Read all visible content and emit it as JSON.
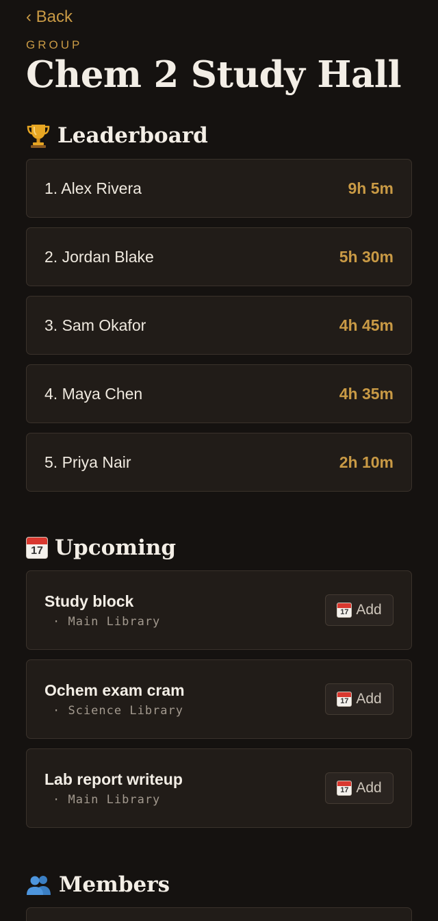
{
  "nav": {
    "back_label": "‹ Back"
  },
  "header": {
    "eyebrow": "GROUP",
    "title": "Chem 2 Study Hall"
  },
  "leaderboard": {
    "heading": "Leaderboard",
    "icon": "trophy-icon",
    "rows": [
      {
        "label": "1. Alex Rivera",
        "time": "9h 5m"
      },
      {
        "label": "2. Jordan Blake",
        "time": "5h 30m"
      },
      {
        "label": "3. Sam Okafor",
        "time": "4h 45m"
      },
      {
        "label": "4. Maya Chen",
        "time": "4h 35m"
      },
      {
        "label": "5. Priya Nair",
        "time": "2h 10m"
      }
    ]
  },
  "upcoming": {
    "heading": "Upcoming",
    "icon": "calendar-icon",
    "add_label": "Add",
    "events": [
      {
        "title": "Study block",
        "meta": "· Main Library"
      },
      {
        "title": "Ochem exam cram",
        "meta": "· Science Library"
      },
      {
        "title": "Lab report writeup",
        "meta": "· Main Library"
      }
    ]
  },
  "members": {
    "heading": "Members",
    "icon": "members-icon"
  },
  "colors": {
    "background": "#151210",
    "card": "#211c18",
    "accent": "#c99a45",
    "text": "#efe9df"
  }
}
